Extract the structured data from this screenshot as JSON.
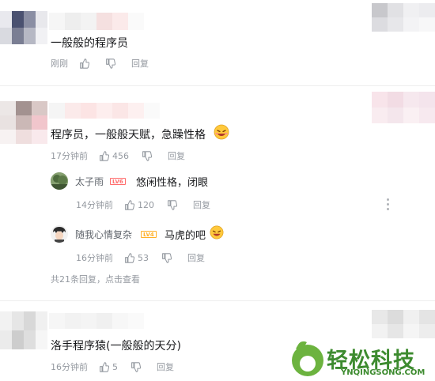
{
  "comments": [
    {
      "text": "一般般的程序员",
      "time": "刚刚",
      "likes": "",
      "reply_label": "回复"
    },
    {
      "text": "程序员，一般般天赋，急躁性格",
      "emoji": "laughing-face-emoji",
      "time": "17分钟前",
      "likes": "456",
      "reply_label": "回复",
      "replies": [
        {
          "user": "太子雨",
          "level": "LV6",
          "level_color": "#ff6c6c",
          "text": "悠闲性格，闭眼",
          "time": "14分钟前",
          "likes": "120",
          "reply_label": "回复"
        },
        {
          "user": "随我心情复杂",
          "level": "LV4",
          "level_color": "#ffb027",
          "text": "马虎的吧",
          "emoji": "laughing-face-emoji",
          "time": "16分钟前",
          "likes": "53",
          "reply_label": "回复"
        }
      ],
      "more_replies": "共21条回复，",
      "view_link": "点击查看"
    },
    {
      "text": "洛手程序猿(一般般的天分)",
      "time": "16分钟前",
      "likes": "5",
      "reply_label": "回复"
    }
  ],
  "watermark": {
    "name": "轻松科技",
    "domain": "YNQINGSONG.COM",
    "color": "#3d8b2f"
  },
  "icons": [
    "thumb-up-icon",
    "thumb-down-icon",
    "more-options-icon"
  ]
}
